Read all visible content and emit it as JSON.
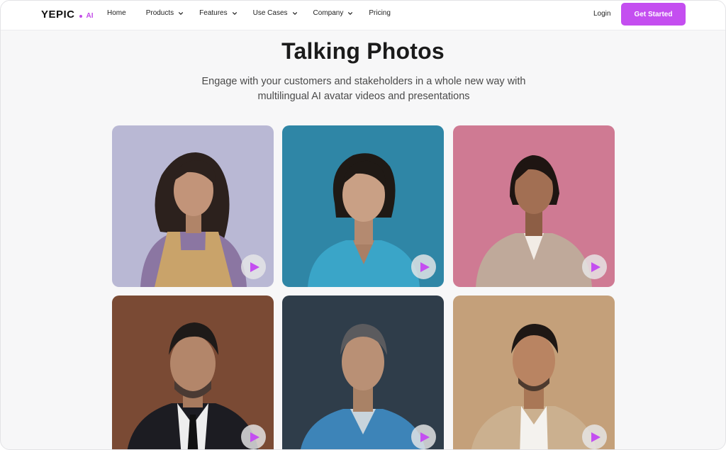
{
  "brand": {
    "name": "YEPIC",
    "suffix": "AI",
    "accent": "#c44ef0"
  },
  "nav": {
    "items": [
      {
        "label": "Home",
        "has_dropdown": false
      },
      {
        "label": "Products",
        "has_dropdown": true
      },
      {
        "label": "Features",
        "has_dropdown": true
      },
      {
        "label": "Use Cases",
        "has_dropdown": true
      },
      {
        "label": "Company",
        "has_dropdown": true
      },
      {
        "label": "Pricing",
        "has_dropdown": false
      }
    ],
    "login_label": "Login",
    "cta_label": "Get Started"
  },
  "hero": {
    "title": "Talking Photos",
    "subtitle": "Engage with your customers and stakeholders in a whole new way with multilingual AI avatar videos and presentations"
  },
  "avatars": [
    {
      "subject": "woman-apron",
      "background": "#b9b8d4",
      "play_icon": "play-icon"
    },
    {
      "subject": "woman-scrubs",
      "background": "#2f86a6",
      "play_icon": "play-icon"
    },
    {
      "subject": "woman-blazer",
      "background": "#cf7a93",
      "play_icon": "play-icon"
    },
    {
      "subject": "man-suit",
      "background": "#7a4a34",
      "play_icon": "play-icon"
    },
    {
      "subject": "man-scrubs",
      "background": "#2f3d4a",
      "play_icon": "play-icon"
    },
    {
      "subject": "man-shirt",
      "background": "#c4a07a",
      "play_icon": "play-icon"
    }
  ]
}
